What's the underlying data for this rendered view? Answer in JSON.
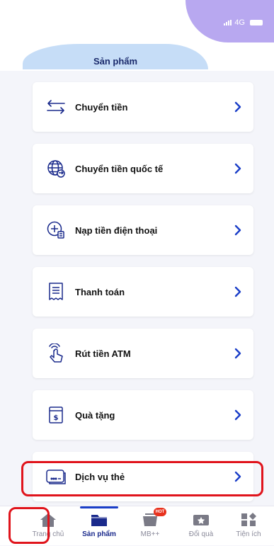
{
  "status_bar": {
    "network": "4G"
  },
  "header": {
    "title": "Sản phẩm"
  },
  "menu": {
    "items": [
      {
        "label": "Chuyển tiền",
        "icon": "transfer-arrows-icon"
      },
      {
        "label": "Chuyển tiền quốc tế",
        "icon": "globe-transfer-icon"
      },
      {
        "label": "Nạp tiền điện thoại",
        "icon": "topup-icon"
      },
      {
        "label": "Thanh toán",
        "icon": "receipt-icon"
      },
      {
        "label": "Rút tiền ATM",
        "icon": "atm-withdraw-icon"
      },
      {
        "label": "Quà tặng",
        "icon": "gift-voucher-icon"
      },
      {
        "label": "Dịch vụ thẻ",
        "icon": "card-service-icon"
      }
    ]
  },
  "tabbar": {
    "tabs": [
      {
        "label": "Trang chủ",
        "icon": "home-icon"
      },
      {
        "label": "Sản phẩm",
        "icon": "folder-icon",
        "active": true
      },
      {
        "label": "MB++",
        "icon": "shop-icon",
        "badge": "HOT"
      },
      {
        "label": "Đổi quà",
        "icon": "ticket-star-icon"
      },
      {
        "label": "Tiện ích",
        "icon": "grid-icon"
      }
    ]
  },
  "colors": {
    "accent": "#1a3ec8",
    "highlight": "#e0141c",
    "header_blob": "#b8a8f0",
    "title_tab": "#c6ddf7"
  }
}
